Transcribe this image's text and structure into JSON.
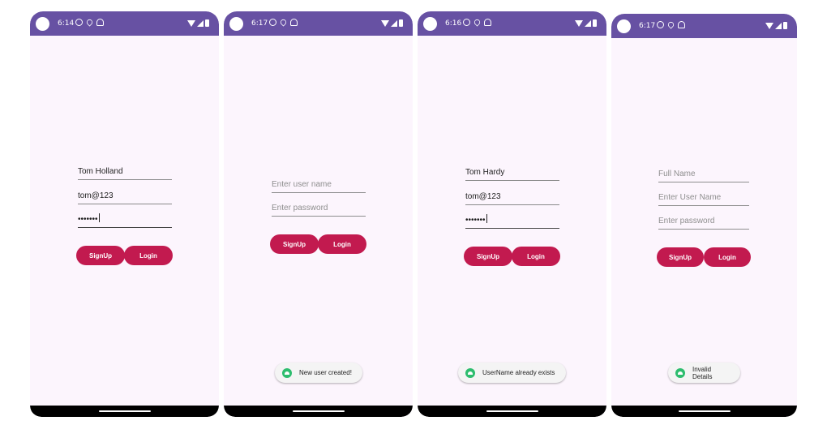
{
  "screens": [
    {
      "time": "6:14",
      "fields": [
        {
          "value": "Tom Holland",
          "placeholder": ""
        },
        {
          "value": "tom@123",
          "placeholder": ""
        },
        {
          "value": "•••••••",
          "placeholder": ""
        }
      ],
      "signup_label": "SignUp",
      "login_label": "Login",
      "toast": ""
    },
    {
      "time": "6:17",
      "fields": [
        {
          "value": "",
          "placeholder": "Enter user name"
        },
        {
          "value": "",
          "placeholder": "Enter password"
        }
      ],
      "signup_label": "SignUp",
      "login_label": "Login",
      "toast": "New user created!"
    },
    {
      "time": "6:16",
      "fields": [
        {
          "value": "Tom Hardy",
          "placeholder": ""
        },
        {
          "value": "tom@123",
          "placeholder": ""
        },
        {
          "value": "•••••••",
          "placeholder": ""
        }
      ],
      "signup_label": "SignUp",
      "login_label": "Login",
      "toast": "UserName already exists"
    },
    {
      "time": "6:17",
      "fields": [
        {
          "value": "",
          "placeholder": "Full Name"
        },
        {
          "value": "",
          "placeholder": "Enter User Name"
        },
        {
          "value": "",
          "placeholder": "Enter password"
        }
      ],
      "signup_label": "SignUp",
      "login_label": "Login",
      "toast": "Invalid Details"
    }
  ],
  "colors": {
    "status_bar": "#6751a3",
    "background": "#fcf5fd",
    "button": "#c21a4f",
    "toast_icon": "#2dbd6e"
  }
}
